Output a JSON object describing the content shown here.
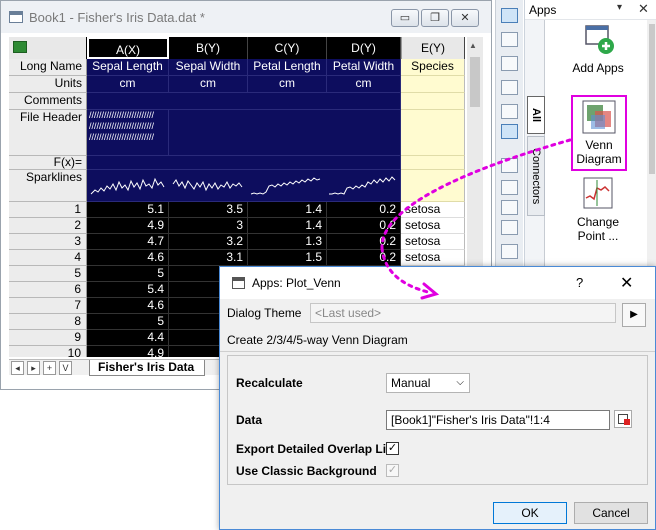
{
  "workbook": {
    "title": "Book1 - Fisher's Iris Data.dat *",
    "buttons": {
      "minimize": "▭",
      "restore": "❐",
      "close": "✕"
    },
    "columns": [
      "A(X)",
      "B(Y)",
      "C(Y)",
      "D(Y)",
      "E(Y)"
    ],
    "row_headers": [
      "Long Name",
      "Units",
      "Comments",
      "File Header",
      "F(x)=",
      "Sparklines"
    ],
    "long_names": [
      "Sepal Length",
      "Sepal Width",
      "Petal Length",
      "Petal Width",
      "Species"
    ],
    "units": [
      "cm",
      "cm",
      "cm",
      "cm",
      ""
    ],
    "file_header_text": "//////////////////////////\n//////////////////////////\n//////////////////////////",
    "rows": [
      {
        "n": "1",
        "a": "5.1",
        "b": "3.5",
        "c": "1.4",
        "d": "0.2",
        "e": "setosa"
      },
      {
        "n": "2",
        "a": "4.9",
        "b": "3",
        "c": "1.4",
        "d": "0.2",
        "e": "setosa"
      },
      {
        "n": "3",
        "a": "4.7",
        "b": "3.2",
        "c": "1.3",
        "d": "0.2",
        "e": "setosa"
      },
      {
        "n": "4",
        "a": "4.6",
        "b": "3.1",
        "c": "1.5",
        "d": "0.2",
        "e": "setosa"
      },
      {
        "n": "5",
        "a": "5",
        "b": "",
        "c": "",
        "d": "",
        "e": ""
      },
      {
        "n": "6",
        "a": "5.4",
        "b": "",
        "c": "",
        "d": "",
        "e": ""
      },
      {
        "n": "7",
        "a": "4.6",
        "b": "",
        "c": "",
        "d": "",
        "e": ""
      },
      {
        "n": "8",
        "a": "5",
        "b": "",
        "c": "",
        "d": "",
        "e": ""
      },
      {
        "n": "9",
        "a": "4.4",
        "b": "",
        "c": "",
        "d": "",
        "e": ""
      },
      {
        "n": "10",
        "a": "4.9",
        "b": "",
        "c": "",
        "d": "",
        "e": ""
      }
    ],
    "sheet_nav": [
      "◂",
      "▸",
      "+",
      "V"
    ],
    "sheet_tab": "Fisher's Iris Data"
  },
  "apps": {
    "title": "Apps",
    "tabs": {
      "all": "All",
      "connectors": "Connectors"
    },
    "items": [
      {
        "label": "Add Apps",
        "icon": "add-apps-icon"
      },
      {
        "label": "Venn\nDiagram",
        "icon": "venn-diagram-icon"
      },
      {
        "label": "Change\nPoint ...",
        "icon": "change-point-icon"
      }
    ]
  },
  "dialog": {
    "title": "Apps: Plot_Venn",
    "help": "?",
    "close": "✕",
    "theme_label": "Dialog Theme",
    "theme_value": "<Last used>",
    "theme_arrow": "▶",
    "description": "Create 2/3/4/5-way Venn Diagram",
    "recalculate_label": "Recalculate",
    "recalculate_value": "Manual",
    "data_label": "Data",
    "data_value": "[Book1]\"Fisher's Iris Data\"!1:4",
    "export_label": "Export Detailed Overlap List",
    "export_checked": "✓",
    "classic_label": "Use Classic Background",
    "classic_checked": "✓",
    "ok": "OK",
    "cancel": "Cancel"
  },
  "colors": {
    "highlight": "#e000e0",
    "label_bg": "#0d0d5e",
    "data_bg": "#000000",
    "species_bg": "#fffbd0"
  }
}
